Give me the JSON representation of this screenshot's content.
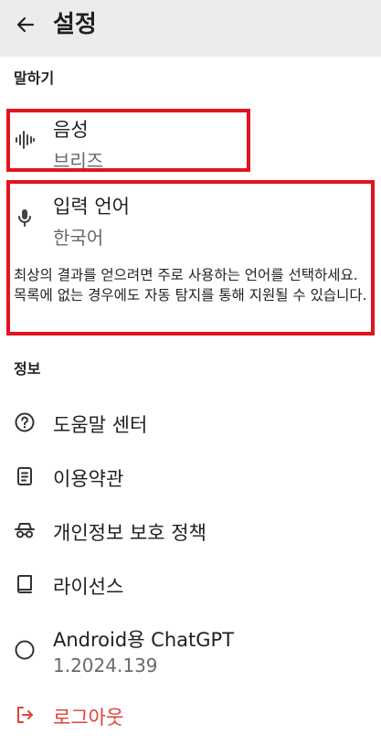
{
  "header": {
    "title": "설정"
  },
  "speaking": {
    "section_label": "말하기",
    "voice": {
      "title": "음성",
      "value": "브리즈"
    },
    "input_language": {
      "title": "입력 언어",
      "value": "한국어",
      "description": "최상의 결과를 얻으려면 주로 사용하는 언어를 선택하세요. 목록에 없는 경우에도 자동 탐지를 통해 지원될 수 있습니다."
    }
  },
  "info": {
    "section_label": "정보",
    "items": [
      {
        "label": "도움말 센터",
        "icon": "help-circle-icon"
      },
      {
        "label": "이용약관",
        "icon": "document-icon"
      },
      {
        "label": "개인정보 보호 정책",
        "icon": "incognito-icon"
      },
      {
        "label": "라이선스",
        "icon": "book-icon"
      }
    ],
    "app_version": {
      "title": "Android용 ChatGPT",
      "version": "1.2024.139"
    },
    "logout": {
      "label": "로그아웃"
    }
  },
  "colors": {
    "highlight": "#e3131e",
    "logout": "#e0403a",
    "topbar": "#ececec"
  }
}
